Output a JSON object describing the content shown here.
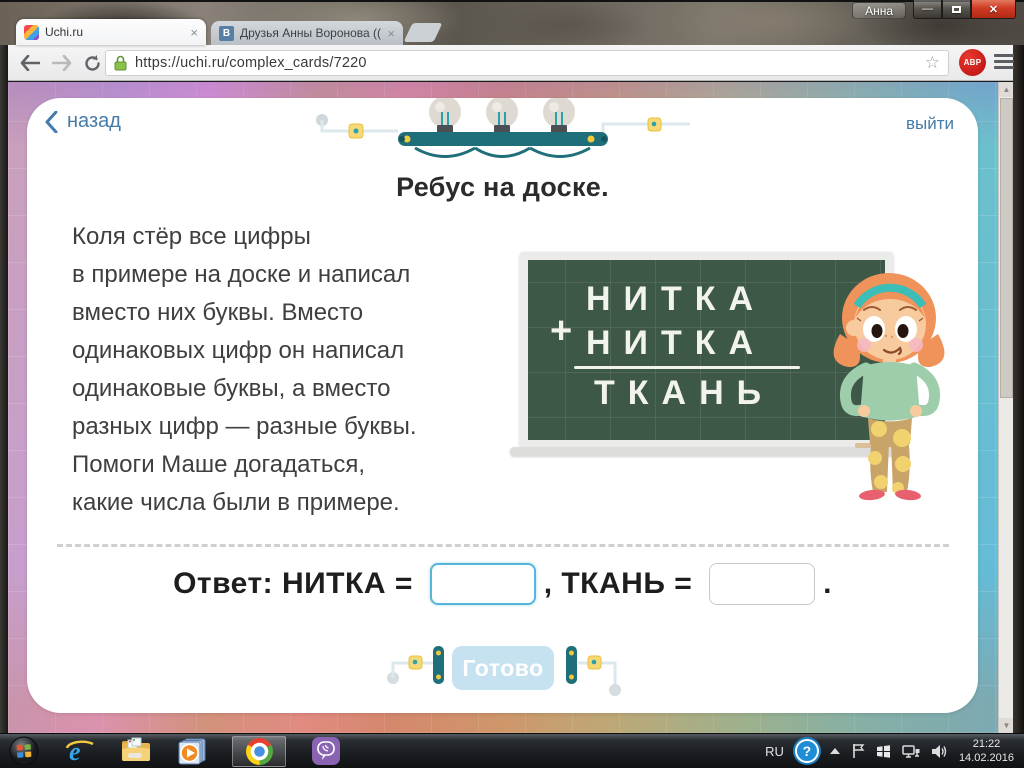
{
  "browser": {
    "tabs": [
      {
        "label": "Uchi.ru"
      },
      {
        "label": "Друзья Анны Воронова (("
      }
    ],
    "tab_close": "×",
    "profile": "Анна",
    "min_glyph": "—",
    "close_glyph": "✕",
    "url": "https://uchi.ru/complex_cards/7220",
    "star": "☆",
    "abp": "ABP"
  },
  "page": {
    "back": "назад",
    "logout": "выйти",
    "title": "Ребус на доске.",
    "task": [
      "Коля стёр все цифры",
      "в примере на доске и написал",
      "вместо них буквы. Вместо",
      "одинаковых цифр он написал",
      "одинаковые буквы, а вместо",
      "разных цифр — разные буквы.",
      "Помоги Маше догадаться,",
      "какие числа были в примере."
    ],
    "board": {
      "plus": "+",
      "addend1": "НИТКА",
      "addend2": "НИТКА",
      "sum": "ТКАНЬ"
    },
    "answer": {
      "label1": "Ответ: НИТКА = ",
      "input1": "",
      "label2": ", ТКАНЬ = ",
      "input2": "",
      "period": ".",
      "submit": "Готово"
    }
  },
  "taskbar": {
    "lang": "RU",
    "help": "?",
    "time": "21:22",
    "date": "14.02.2016"
  },
  "colors": {
    "accent_blue": "#447ba8",
    "board_green": "#3d5847",
    "chalk": "#f3f3ee",
    "done_button": "#c6e2f0",
    "input_focus": "#57b5d9"
  }
}
